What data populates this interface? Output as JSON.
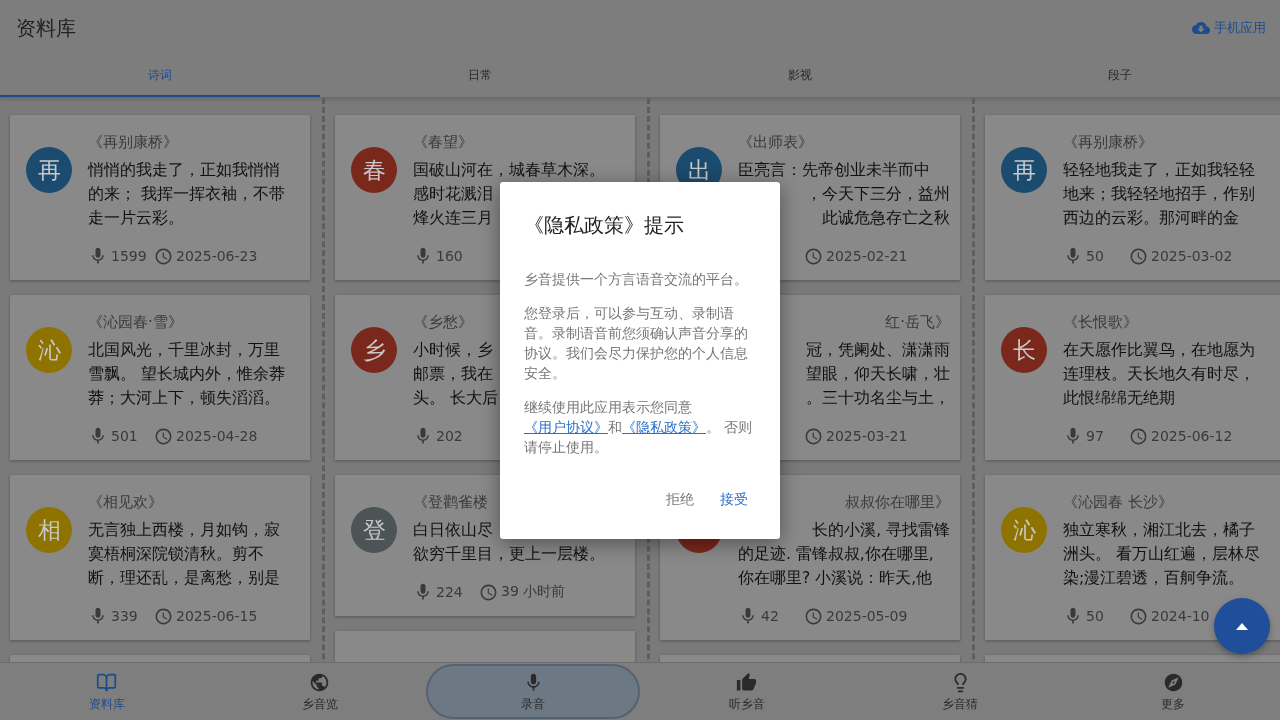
{
  "header": {
    "title": "资料库",
    "app_link": "手机应用"
  },
  "tabs": [
    {
      "label": "诗词",
      "selected": true
    },
    {
      "label": "日常",
      "selected": false
    },
    {
      "label": "影视",
      "selected": false
    },
    {
      "label": "段子",
      "selected": false
    }
  ],
  "columns": [
    {
      "cards": [
        {
          "avatar": {
            "letter": "再",
            "color": "#1b4b6e"
          },
          "title": {
            "text": "《再别康桥》",
            "kind": "full"
          },
          "lines": [
            {
              "text": "悄悄的我走了，正如我悄悄",
              "kind": "full"
            },
            {
              "text": "的来； 我挥一挥衣袖，不带",
              "kind": "full"
            },
            {
              "text": "走一片云彩。",
              "kind": "full"
            }
          ],
          "recordings": "1599",
          "date": "2025-06-23"
        },
        {
          "avatar": {
            "letter": "沁",
            "color": "#8e7300"
          },
          "title": {
            "text": "《沁园春·雪》",
            "kind": "full"
          },
          "lines": [
            {
              "text": "北国风光，千里冰封，万里",
              "kind": "full"
            },
            {
              "text": "雪飘。 望长城内外，惟余莽",
              "kind": "full"
            },
            {
              "text": "莽；大河上下，顿失滔滔。",
              "kind": "full"
            }
          ],
          "recordings": "501",
          "date": "2025-04-28"
        },
        {
          "avatar": {
            "letter": "相",
            "color": "#8e7300"
          },
          "title": {
            "text": "《相见欢》",
            "kind": "full"
          },
          "lines": [
            {
              "text": "无言独上西楼，月如钩，寂",
              "kind": "full"
            },
            {
              "text": "寞梧桐深院锁清秋。剪不",
              "kind": "full"
            },
            {
              "text": "断，理还乱，是离愁，别是",
              "kind": "full"
            }
          ],
          "recordings": "339",
          "date": "2025-06-15"
        }
      ]
    },
    {
      "cards": [
        {
          "avatar": {
            "letter": "春",
            "color": "#7a271c"
          },
          "title": {
            "text": "《春望》",
            "kind": "full"
          },
          "lines": [
            {
              "text": "国破山河在，城春草木深。",
              "kind": "full"
            },
            {
              "text": "感时花溅泪",
              "kind": "full"
            },
            {
              "text": "烽火连三月",
              "kind": "full"
            }
          ],
          "recordings": "160"
        },
        {
          "avatar": {
            "letter": "乡",
            "color": "#7a271c"
          },
          "title": {
            "text": "《乡愁》",
            "kind": "full"
          },
          "lines": [
            {
              "text": "小时候，乡",
              "kind": "full"
            },
            {
              "text": "邮票，我在",
              "kind": "full"
            },
            {
              "text": "头。 长大后",
              "kind": "full"
            }
          ],
          "recordings": "202"
        },
        {
          "avatar": {
            "letter": "登",
            "color": "#4c5456"
          },
          "title": {
            "text": "《登鹳雀楼",
            "kind": "full"
          },
          "lines": [
            {
              "text": "白日依山尽",
              "kind": "full"
            },
            {
              "text": "欲穷千里目，更上一层楼。",
              "kind": "full"
            }
          ],
          "recordings": "224",
          "date": "39 小时前"
        }
      ]
    },
    {
      "cards": [
        {
          "avatar": {
            "letter": "出",
            "color": "#1b4b6e"
          },
          "title": {
            "text": "《出师表》",
            "kind": "full"
          },
          "lines": [
            {
              "text": "臣亮言：先帝创业未半而中",
              "kind": "full"
            },
            {
              "text": "，今天下三分，益州",
              "kind": "tail"
            },
            {
              "text": "此诚危急存亡之秋",
              "kind": "tail"
            }
          ],
          "date": "2025-02-21"
        },
        {
          "title": {
            "text": "红·岳飞》",
            "kind": "tail"
          },
          "lines": [
            {
              "text": "冠，凭阑处、潇潇雨",
              "kind": "tail"
            },
            {
              "text": "望眼，仰天长啸，壮",
              "kind": "tail"
            },
            {
              "text": "。三十功名尘与土，",
              "kind": "tail"
            }
          ],
          "date": "2025-03-21"
        },
        {
          "avatar": {
            "color": "#7a271c"
          },
          "title": {
            "text": "叔叔你在哪里》",
            "kind": "tail"
          },
          "lines": [
            {
              "text": "长的小溪, 寻找雷锋",
              "kind": "tail"
            },
            {
              "text": "的足迹. 雷锋叔叔,你在哪里,",
              "kind": "full"
            },
            {
              "text": "你在哪里? 小溪说：昨天,他",
              "kind": "full"
            }
          ],
          "recordings": "42",
          "date": "2025-05-09"
        }
      ]
    },
    {
      "cards": [
        {
          "avatar": {
            "letter": "再",
            "color": "#1b4b6e"
          },
          "title": {
            "text": "《再别康桥》",
            "kind": "full"
          },
          "lines": [
            {
              "text": "轻轻地我走了，正如我轻轻",
              "kind": "full"
            },
            {
              "text": "地来；我轻轻地招手，作别",
              "kind": "full"
            },
            {
              "text": "西边的云彩。那河畔的金",
              "kind": "full"
            }
          ],
          "recordings": "50",
          "date": "2025-03-02"
        },
        {
          "avatar": {
            "letter": "长",
            "color": "#7a271c"
          },
          "title": {
            "text": "《长恨歌》",
            "kind": "full"
          },
          "lines": [
            {
              "text": "在天愿作比翼鸟，在地愿为",
              "kind": "full"
            },
            {
              "text": "连理枝。天长地久有时尽，",
              "kind": "full"
            },
            {
              "text": "此恨绵绵无绝期",
              "kind": "full"
            }
          ],
          "recordings": "97",
          "date": "2025-06-12"
        },
        {
          "avatar": {
            "letter": "沁",
            "color": "#8e7300"
          },
          "title": {
            "text": "《沁园春 长沙》",
            "kind": "full"
          },
          "lines": [
            {
              "text": "独立寒秋，湘江北去，橘子",
              "kind": "full"
            },
            {
              "text": "洲头。 看万山红遍，层林尽",
              "kind": "full"
            },
            {
              "text": "染;漫江碧透，百舸争流。",
              "kind": "full"
            }
          ],
          "recordings": "50",
          "date": "2024-10"
        }
      ]
    }
  ],
  "bottom_nav": [
    {
      "label": "资料库",
      "selected": true,
      "kind": "tab"
    },
    {
      "label": "乡音览",
      "selected": false,
      "kind": "tab"
    },
    {
      "label": "录音",
      "selected": false,
      "kind": "center"
    },
    {
      "label": "听乡音",
      "selected": false,
      "kind": "tab"
    },
    {
      "label": "乡音猜",
      "selected": false,
      "kind": "tab"
    },
    {
      "label": "更多",
      "selected": false,
      "kind": "tab"
    }
  ],
  "dialog": {
    "title": "《隐私政策》提示",
    "paragraphs": [
      "乡音提供一个方言语音交流的平台。",
      "您登录后，可以参与互动、录制语音。录制语音前您须确认声音分享的协议。我们会尽力保护您的个人信息安全。"
    ],
    "consent": [
      {
        "kind": "text",
        "text": "继续使用此应用表示您同意 "
      },
      {
        "kind": "link",
        "text": "《用户协议》"
      },
      {
        "kind": "text",
        "text": "和"
      },
      {
        "kind": "link",
        "text": "《隐私政策》"
      },
      {
        "kind": "text",
        "text": "。 否则请停止使用。"
      }
    ],
    "buttons": [
      {
        "label": "拒绝",
        "kind": "secondary"
      },
      {
        "label": "接受",
        "kind": "primary"
      }
    ]
  }
}
